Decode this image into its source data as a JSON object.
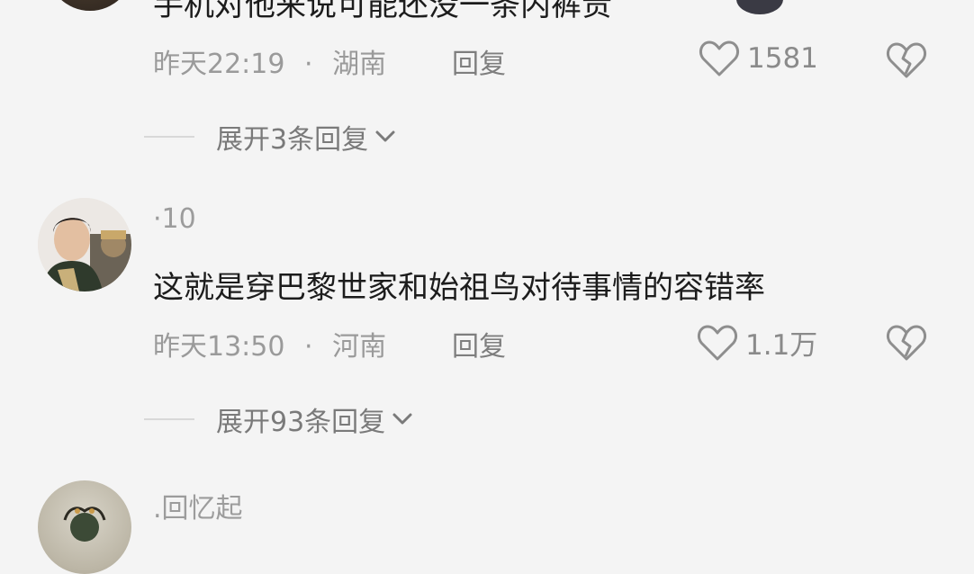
{
  "comments": [
    {
      "text": "手机对他来说可能还没一条内裤贵",
      "time": "昨天22:19",
      "separator": "·",
      "region": "湖南",
      "reply_label": "回复",
      "likes": "1581",
      "expand_label": "展开3条回复"
    },
    {
      "username": "·10",
      "text": "这就是穿巴黎世家和始祖鸟对待事情的容错率",
      "time": "昨天13:50",
      "separator": "·",
      "region": "河南",
      "reply_label": "回复",
      "likes": "1.1万",
      "expand_label": "展开93条回复"
    },
    {
      "username": ".回忆起"
    }
  ],
  "icons": {
    "like": "heart-outline-icon",
    "dislike": "broken-heart-icon",
    "expand": "chevron-down-icon"
  },
  "colors": {
    "background": "#f4f4f4",
    "text": "#1c1c1c",
    "meta": "#9a9a9a"
  }
}
